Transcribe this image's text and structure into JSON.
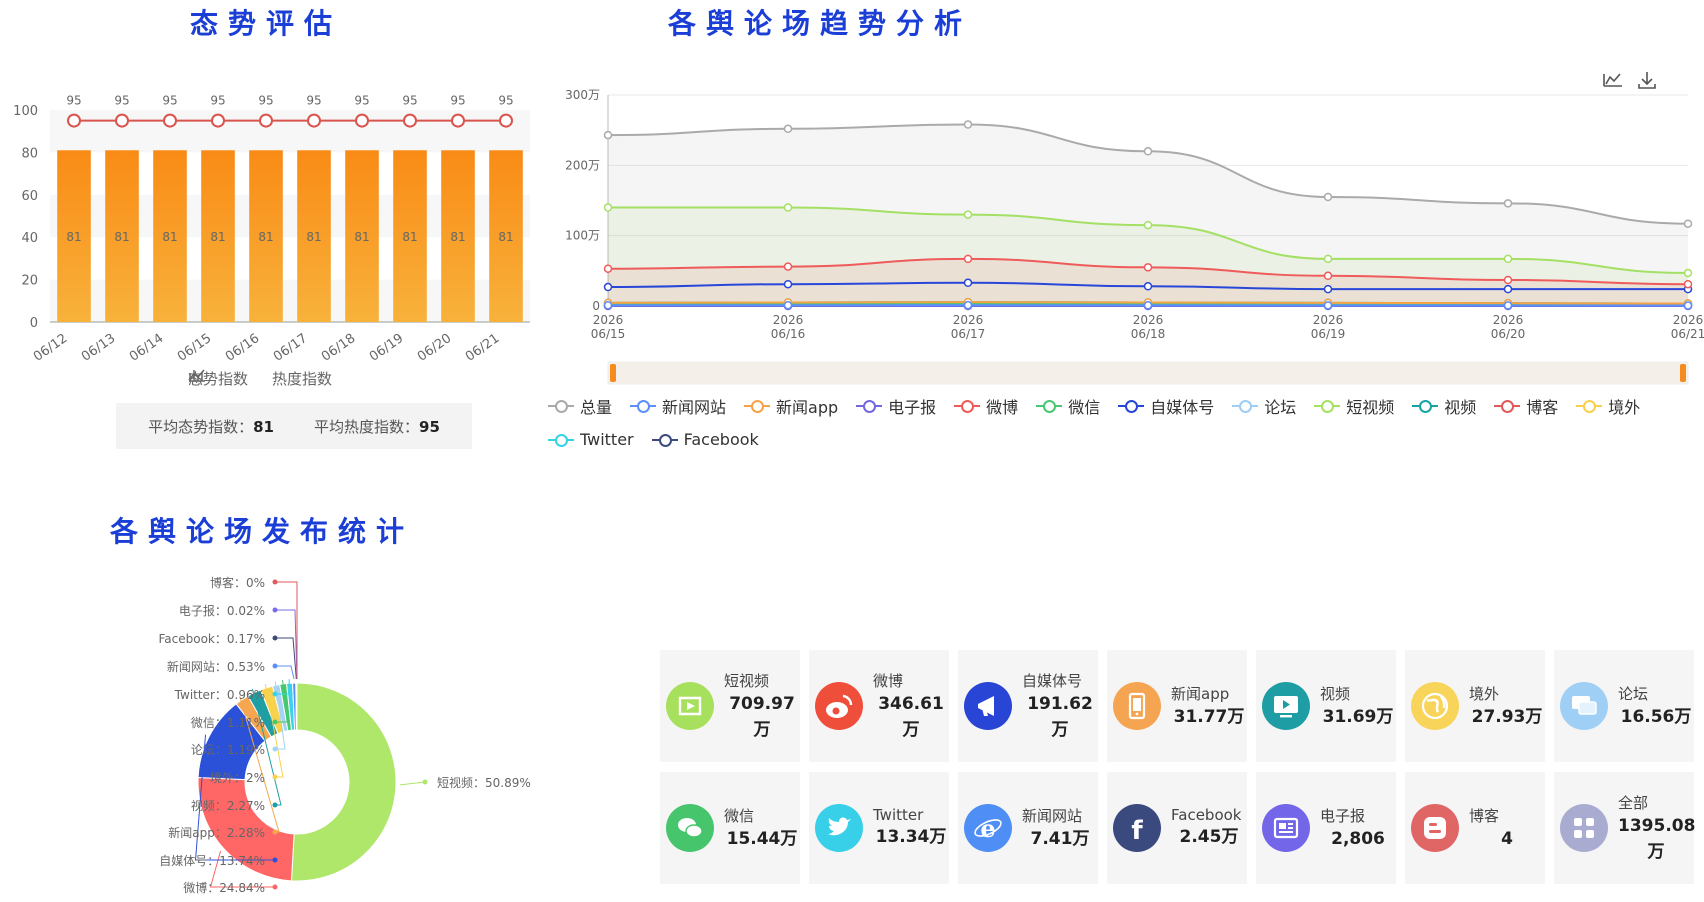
{
  "titles": {
    "situation": "态势评估",
    "trend": "各舆论场趋势分析",
    "stats": "各舆论场发布统计"
  },
  "chart_data": [
    {
      "type": "bar",
      "name": "situation",
      "categories": [
        "06/12",
        "06/13",
        "06/14",
        "06/15",
        "06/16",
        "06/17",
        "06/18",
        "06/19",
        "06/20",
        "06/21"
      ],
      "series": [
        {
          "name": "态势指数",
          "type": "bar",
          "values": [
            81,
            81,
            81,
            81,
            81,
            81,
            81,
            81,
            81,
            81
          ]
        },
        {
          "name": "热度指数",
          "type": "line",
          "values": [
            95,
            95,
            95,
            95,
            95,
            95,
            95,
            95,
            95,
            95
          ]
        }
      ],
      "ylim": [
        0,
        100
      ],
      "yticks": [
        0,
        20,
        40,
        60,
        80,
        100
      ],
      "legend_position": "bottom",
      "colors": {
        "bar_top": "#f98b16",
        "bar_bottom": "#f8b23b",
        "line": "#d9534f"
      }
    },
    {
      "type": "line",
      "name": "trend",
      "x": [
        "2026\n06/15",
        "2026\n06/16",
        "2026\n06/17",
        "2026\n06/18",
        "2026\n06/19",
        "2026\n06/20",
        "2026\n06/21"
      ],
      "x_top": [
        "2026",
        "2026",
        "2026",
        "2026",
        "2026",
        "2026",
        "2026"
      ],
      "x_bottom": [
        "06/15",
        "06/16",
        "06/17",
        "06/18",
        "06/19",
        "06/20",
        "06/21"
      ],
      "yticks": [
        0,
        100,
        200,
        300
      ],
      "ytick_labels": [
        "0",
        "100万",
        "200万",
        "300万"
      ],
      "ylim": [
        0,
        300
      ],
      "y_unit": "万",
      "smooth": true,
      "series": [
        {
          "name": "总量",
          "color": "#aaaaaa",
          "area": true,
          "values": [
            243,
            252,
            258,
            220,
            155,
            146,
            117
          ]
        },
        {
          "name": "新闻网站",
          "color": "#5b8ff9",
          "values": [
            1.0,
            1.1,
            1.2,
            1.0,
            0.9,
            0.8,
            0.7
          ]
        },
        {
          "name": "新闻app",
          "color": "#f5a346",
          "values": [
            4.5,
            5.0,
            5.5,
            5.0,
            4.5,
            4.0,
            3.5
          ]
        },
        {
          "name": "电子报",
          "color": "#7267e0",
          "values": [
            0,
            0,
            0,
            0,
            0,
            0,
            0
          ]
        },
        {
          "name": "微博",
          "color": "#ef5b5b",
          "area": true,
          "values": [
            53,
            56,
            67,
            55,
            43,
            37,
            31
          ]
        },
        {
          "name": "微信",
          "color": "#48c774",
          "values": [
            2.5,
            2.5,
            3,
            2.5,
            2,
            2,
            1.5
          ]
        },
        {
          "name": "自媒体号",
          "color": "#2847d8",
          "values": [
            27,
            31,
            33,
            28,
            24,
            24,
            24
          ]
        },
        {
          "name": "论坛",
          "color": "#9ecef7",
          "values": [
            2.5,
            2.5,
            3,
            2.5,
            2,
            2,
            1.5
          ]
        },
        {
          "name": "短视频",
          "color": "#a4e063",
          "area": true,
          "values": [
            140,
            140,
            130,
            115,
            67,
            67,
            47
          ]
        },
        {
          "name": "视频",
          "color": "#1aa3a3",
          "values": [
            4.5,
            5,
            5.5,
            5,
            4.5,
            4,
            3.5
          ]
        },
        {
          "name": "博客",
          "color": "#e05a5a",
          "values": [
            0,
            0,
            0,
            0,
            0,
            0,
            0
          ]
        },
        {
          "name": "境外",
          "color": "#f7cf4a",
          "values": [
            4,
            4.5,
            5,
            4.5,
            4,
            3.5,
            3
          ]
        },
        {
          "name": "Twitter",
          "color": "#33d3e6",
          "values": [
            2,
            2.2,
            2.5,
            2,
            1.8,
            1.6,
            1.3
          ]
        },
        {
          "name": "Facebook",
          "color": "#3d4a80",
          "values": [
            0.4,
            0.4,
            0.5,
            0.4,
            0.3,
            0.3,
            0.3
          ]
        }
      ],
      "legend_position": "bottom",
      "grid": true
    },
    {
      "type": "pie",
      "name": "stats",
      "donut": true,
      "slices": [
        {
          "name": "短视频",
          "label": "短视频：50.89%",
          "value": 50.89,
          "color": "#aee76a"
        },
        {
          "name": "微博",
          "label": "微博：24.84%",
          "value": 24.84,
          "color": "#ff6666"
        },
        {
          "name": "自媒体号",
          "label": "自媒体号：13.74%",
          "value": 13.74,
          "color": "#2b51d9"
        },
        {
          "name": "新闻app",
          "label": "新闻app：2.28%",
          "value": 2.28,
          "color": "#f5a64e"
        },
        {
          "name": "视频",
          "label": "视频：2.27%",
          "value": 2.27,
          "color": "#1f9fa3"
        },
        {
          "name": "境外",
          "label": "境外：2%",
          "value": 2.0,
          "color": "#f8d24c"
        },
        {
          "name": "论坛",
          "label": "论坛：1.19%",
          "value": 1.19,
          "color": "#a4d3f6"
        },
        {
          "name": "微信",
          "label": "微信：1.11%",
          "value": 1.11,
          "color": "#46c86e"
        },
        {
          "name": "Twitter",
          "label": "Twitter：0.96%",
          "value": 0.96,
          "color": "#3ad2ea"
        },
        {
          "name": "新闻网站",
          "label": "新闻网站：0.53%",
          "value": 0.53,
          "color": "#5c8ff9"
        },
        {
          "name": "Facebook",
          "label": "Facebook：0.17%",
          "value": 0.17,
          "color": "#3d4a78"
        },
        {
          "name": "电子报",
          "label": "电子报：0.02%",
          "value": 0.02,
          "color": "#7a6ce8"
        },
        {
          "name": "博客",
          "label": "博客：0%",
          "value": 0.0,
          "color": "#e05a5a"
        }
      ]
    }
  ],
  "legend1": {
    "bar": "态势指数",
    "line": "热度指数"
  },
  "averages": {
    "situation_label": "平均态势指数：",
    "situation_value": "81",
    "heat_label": "平均热度指数：",
    "heat_value": "95"
  },
  "cards": [
    {
      "name": "短视频",
      "value": "709.97万",
      "lines": [
        "709.97",
        "万"
      ],
      "color": "#a6e05c",
      "icon": "play-icon"
    },
    {
      "name": "微博",
      "value": "346.61万",
      "lines": [
        "346.61",
        "万"
      ],
      "color": "#ef4e3b",
      "icon": "weibo-icon"
    },
    {
      "name": "自媒体号",
      "value": "191.62万",
      "lines": [
        "191.62",
        "万"
      ],
      "color": "#2845d6",
      "icon": "megaphone-icon"
    },
    {
      "name": "新闻app",
      "value": "31.77万",
      "lines": [
        "31.77万"
      ],
      "color": "#f5a552",
      "icon": "phone-icon"
    },
    {
      "name": "视频",
      "value": "31.69万",
      "lines": [
        "31.69万"
      ],
      "color": "#1e9ea4",
      "icon": "video-icon"
    },
    {
      "name": "境外",
      "value": "27.93万",
      "lines": [
        "27.93万"
      ],
      "color": "#f8d45a",
      "icon": "globe-icon"
    },
    {
      "name": "论坛",
      "value": "16.56万",
      "lines": [
        "16.56万"
      ],
      "color": "#9fcff5",
      "icon": "chat-icon"
    },
    {
      "name": "微信",
      "value": "15.44万",
      "lines": [
        "15.44万"
      ],
      "color": "#47c56c",
      "icon": "wechat-icon"
    },
    {
      "name": "Twitter",
      "value": "13.34万",
      "lines": [
        "13.34万"
      ],
      "color": "#38cfe8",
      "icon": "twitter-icon"
    },
    {
      "name": "新闻网站",
      "value": "7.41万",
      "lines": [
        "7.41万"
      ],
      "color": "#4f8ff5",
      "icon": "ie-icon"
    },
    {
      "name": "Facebook",
      "value": "2.45万",
      "lines": [
        "2.45万"
      ],
      "color": "#3b4a7e",
      "icon": "facebook-icon"
    },
    {
      "name": "电子报",
      "value": "2,806",
      "lines": [
        "2,806"
      ],
      "color": "#7366e8",
      "icon": "newspaper-icon"
    },
    {
      "name": "博客",
      "value": "4",
      "lines": [
        "4"
      ],
      "color": "#e06666",
      "icon": "blogger-icon"
    },
    {
      "name": "全部",
      "value": "1395.08万",
      "lines": [
        "1395.08",
        "万"
      ],
      "color": "#a9acd0",
      "icon": "grid-icon"
    }
  ],
  "toolbox": {
    "icons": [
      "area-chart-icon",
      "download-icon"
    ]
  }
}
